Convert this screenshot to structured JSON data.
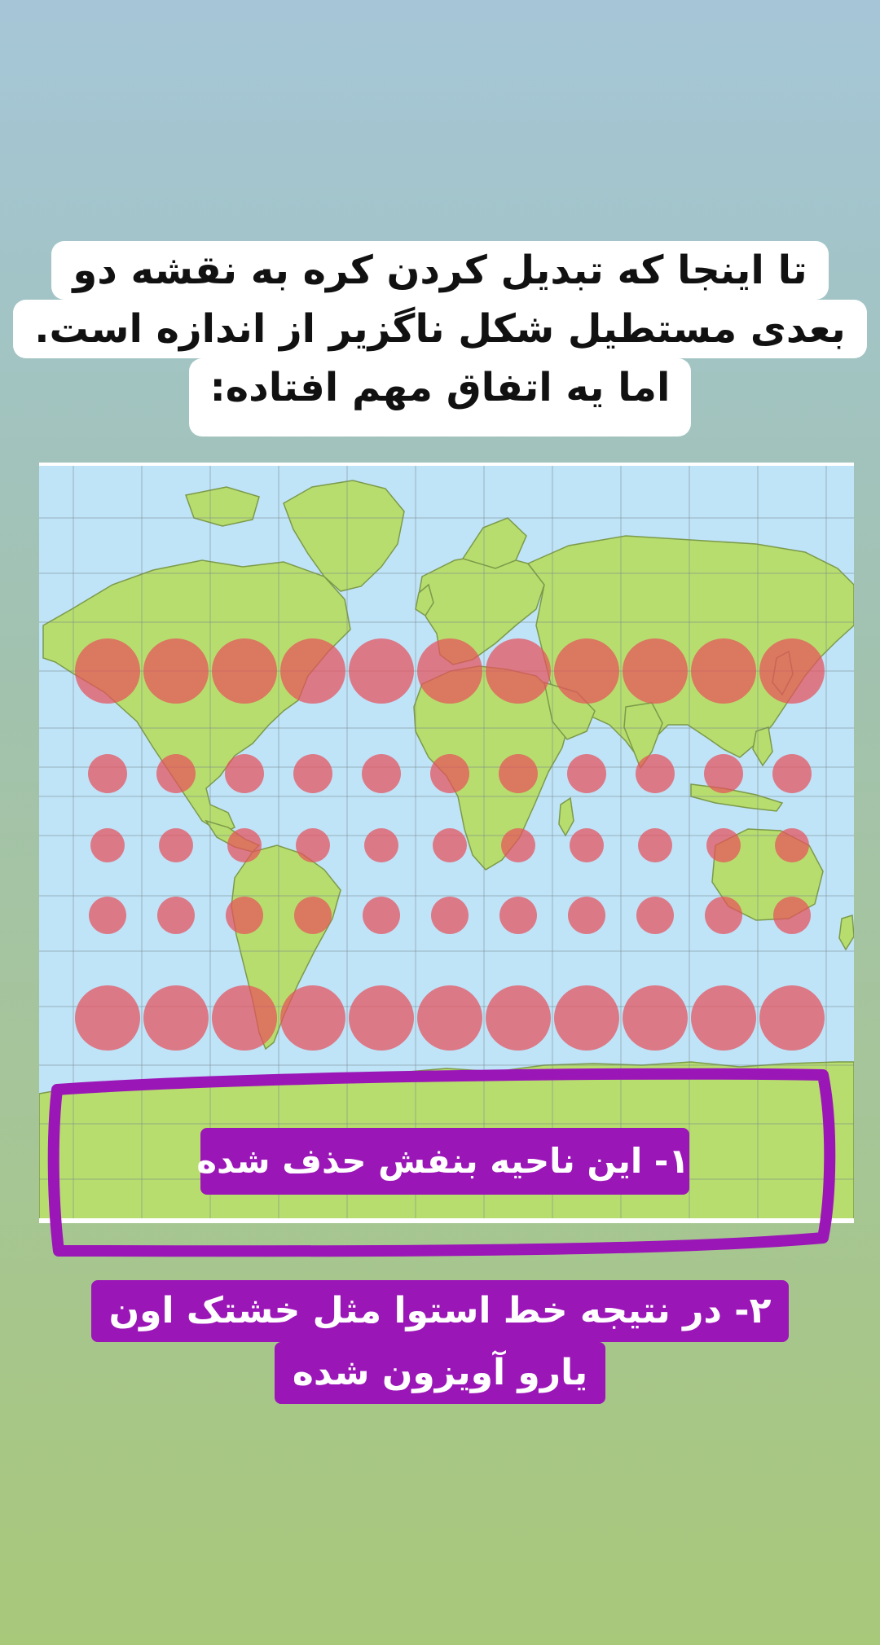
{
  "title": {
    "lines": [
      "تا اینجا که تبدیل کردن کره به نقشه دو",
      "بعدی مستطیل شکل ناگزیر از اندازه است.",
      "اما یه اتفاق مهم افتاده:"
    ]
  },
  "map": {
    "projection": "mercator",
    "ocean_color": "#bfe3f7",
    "land_color": "#b7dd6e",
    "circle_color": "#e8505b",
    "highlight_color": "#9b16b7",
    "circle_rows": 6,
    "circle_cols": 11
  },
  "annotations": {
    "label_1": "۱- این ناحیه بنفش حذف شده",
    "label_2_lines": [
      "۲- در نتیجه خط استوا مثل خشتک اون",
      "یارو آویزون شده"
    ]
  }
}
